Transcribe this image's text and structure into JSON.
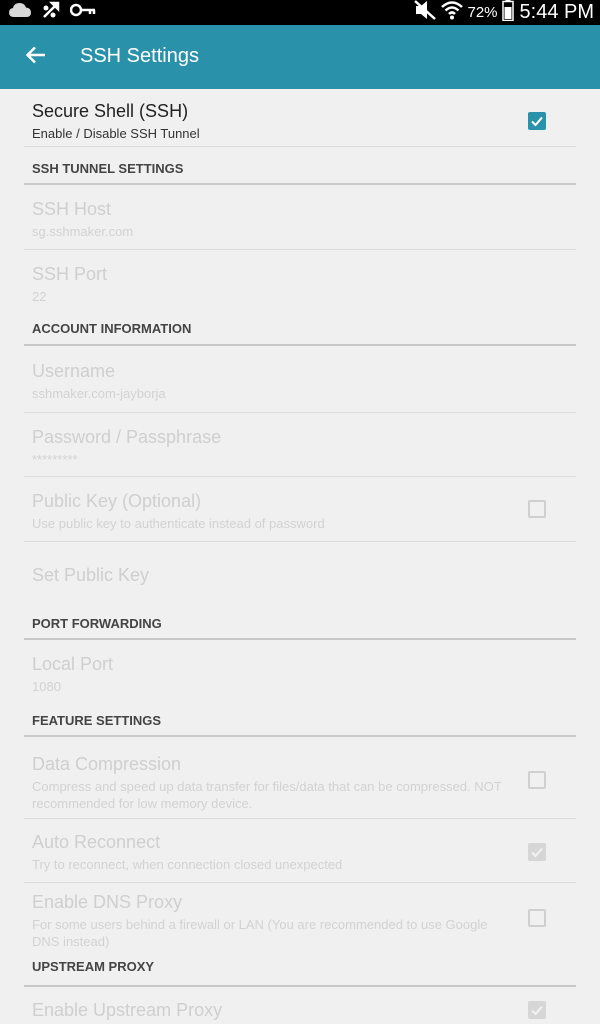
{
  "status_bar": {
    "battery_percent": "72%",
    "time": "5:44 PM"
  },
  "app_bar": {
    "title": "SSH Settings"
  },
  "prefs": {
    "ssh": {
      "title": "Secure Shell (SSH)",
      "summary": "Enable / Disable SSH Tunnel",
      "checked": true
    },
    "tunnel_header": "SSH TUNNEL SETTINGS",
    "host": {
      "title": "SSH Host",
      "summary": "sg.sshmaker.com"
    },
    "port": {
      "title": "SSH Port",
      "summary": "22"
    },
    "account_header": "ACCOUNT INFORMATION",
    "username": {
      "title": "Username",
      "summary": "sshmaker.com-jayborja"
    },
    "password": {
      "title": "Password / Passphrase",
      "summary": "*********"
    },
    "public_key": {
      "title": "Public Key (Optional)",
      "summary": "Use public key to authenticate instead of password",
      "checked": false
    },
    "set_public_key": {
      "title": "Set Public Key"
    },
    "forwarding_header": "PORT FORWARDING",
    "local_port": {
      "title": "Local Port",
      "summary": "1080"
    },
    "feature_header": "FEATURE SETTINGS",
    "compression": {
      "title": "Data Compression",
      "summary": "Compress and speed up data transfer for files/data that can be compressed. NOT recommended for low memory device.",
      "checked": false
    },
    "auto_reconnect": {
      "title": "Auto Reconnect",
      "summary": "Try to reconnect, when connection closed unexpected",
      "checked": true
    },
    "dns_proxy": {
      "title": "Enable DNS Proxy",
      "summary": "For some users behind a firewall or LAN (You are recommended to use Google DNS instead)",
      "checked": false
    },
    "upstream_header": "UPSTREAM PROXY",
    "upstream_proxy": {
      "title": "Enable Upstream Proxy",
      "checked": true
    }
  },
  "colors": {
    "accent": "#2a91aa",
    "background": "#f0f0f0",
    "status_bar": "#000000"
  },
  "icons": [
    "cloud-icon",
    "usb-debug-icon",
    "key-icon",
    "mute-icon",
    "wifi-icon",
    "battery-icon",
    "back-arrow-icon",
    "checkmark-icon"
  ]
}
